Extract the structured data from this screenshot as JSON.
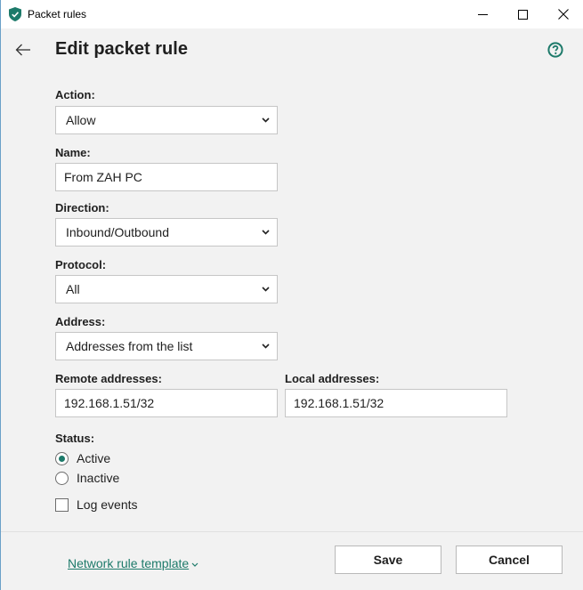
{
  "window": {
    "title": "Packet rules"
  },
  "header": {
    "title": "Edit packet rule"
  },
  "form": {
    "action": {
      "label": "Action:",
      "value": "Allow"
    },
    "name": {
      "label": "Name:",
      "value": "From ZAH PC"
    },
    "direction": {
      "label": "Direction:",
      "value": "Inbound/Outbound"
    },
    "protocol": {
      "label": "Protocol:",
      "value": "All"
    },
    "address": {
      "label": "Address:",
      "value": "Addresses from the list"
    },
    "remote_addresses": {
      "label": "Remote addresses:",
      "value": "192.168.1.51/32"
    },
    "local_addresses": {
      "label": "Local addresses:",
      "value": "192.168.1.51/32"
    },
    "status": {
      "label": "Status:",
      "options": [
        {
          "label": "Active",
          "selected": true
        },
        {
          "label": "Inactive",
          "selected": false
        }
      ]
    },
    "log_events": {
      "label": "Log events",
      "checked": false
    }
  },
  "footer": {
    "template_link": "Network rule template",
    "save_label": "Save",
    "cancel_label": "Cancel"
  },
  "colors": {
    "accent": "#1d7a6a",
    "window_border": "#6aa0c8",
    "background": "#f2f2f2"
  },
  "icons": {
    "app": "kaspersky-shield-icon",
    "back": "arrow-left-icon",
    "help": "question-circle-icon",
    "minimize": "minimize-icon",
    "maximize": "maximize-icon",
    "close": "close-icon",
    "dropdown": "chevron-down-icon"
  }
}
